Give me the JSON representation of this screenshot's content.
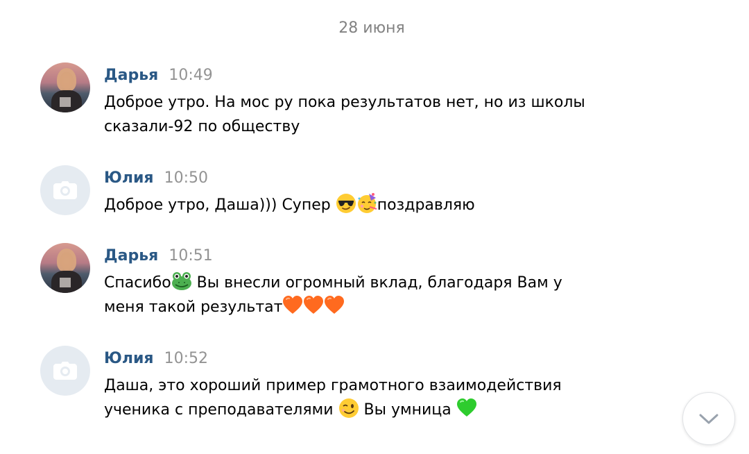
{
  "date_separator": "28 июня",
  "messages": [
    {
      "author": "Дарья",
      "time": "10:49",
      "lines": [
        "Доброе утро. На мос ру пока результатов нет, но из школы",
        "сказали-92 по обществу"
      ]
    },
    {
      "author": "Юлия",
      "time": "10:50",
      "text_a": "Доброе утро, Даша))) Супер ",
      "text_b": "поздравляю",
      "emojis": [
        "sunglasses-emoji",
        "party-face-emoji"
      ]
    },
    {
      "author": "Дарья",
      "time": "10:51",
      "text_a": "Спасибо",
      "text_b": " Вы внесли огромный вклад, благодаря Вам у",
      "text_c": "меня такой результат",
      "emojis": [
        "frog-emoji",
        "orange-heart-emoji",
        "orange-heart-emoji",
        "orange-heart-emoji"
      ]
    },
    {
      "author": "Юлия",
      "time": "10:52",
      "line1": "Даша, это хороший пример грамотного взаимодействия",
      "text_a": "ученика с преподавателями ",
      "text_b": " Вы умница ",
      "emojis": [
        "winking-face-emoji",
        "green-heart-emoji"
      ]
    }
  ],
  "colors": {
    "author": "#2a5885",
    "time": "#939393",
    "date": "#828282",
    "avatar_placeholder": "#e5ebf1"
  },
  "icons": {
    "camera": "camera-icon",
    "scroll_down": "chevron-down-icon"
  }
}
